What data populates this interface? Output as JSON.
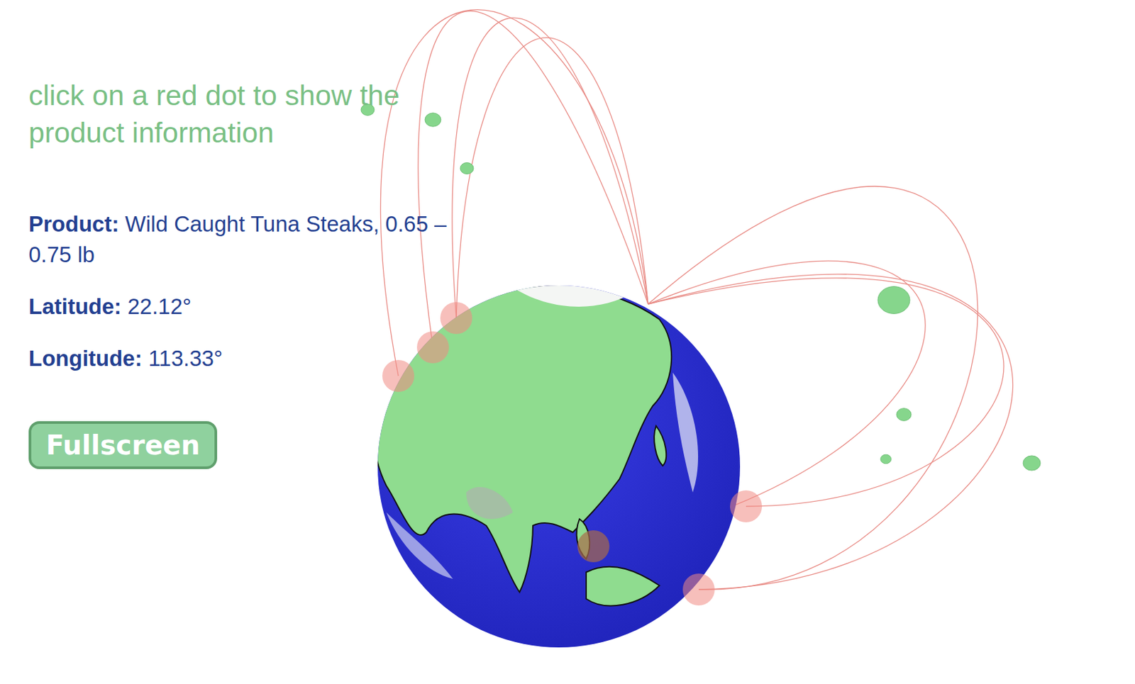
{
  "instruction": "click on a red dot to show the product information",
  "info": [
    {
      "label": "Product:",
      "value": "Wild Caught Tuna Steaks, 0.65 – 0.75 lb"
    },
    {
      "label": "Latitude:",
      "value": "22.12°"
    },
    {
      "label": "Longitude:",
      "value": "113.33°"
    }
  ],
  "button": "Fullscreen",
  "markers": [
    {
      "selected": false
    },
    {
      "selected": false
    },
    {
      "selected": false
    },
    {
      "selected": true
    },
    {
      "selected": false
    },
    {
      "selected": false
    }
  ]
}
